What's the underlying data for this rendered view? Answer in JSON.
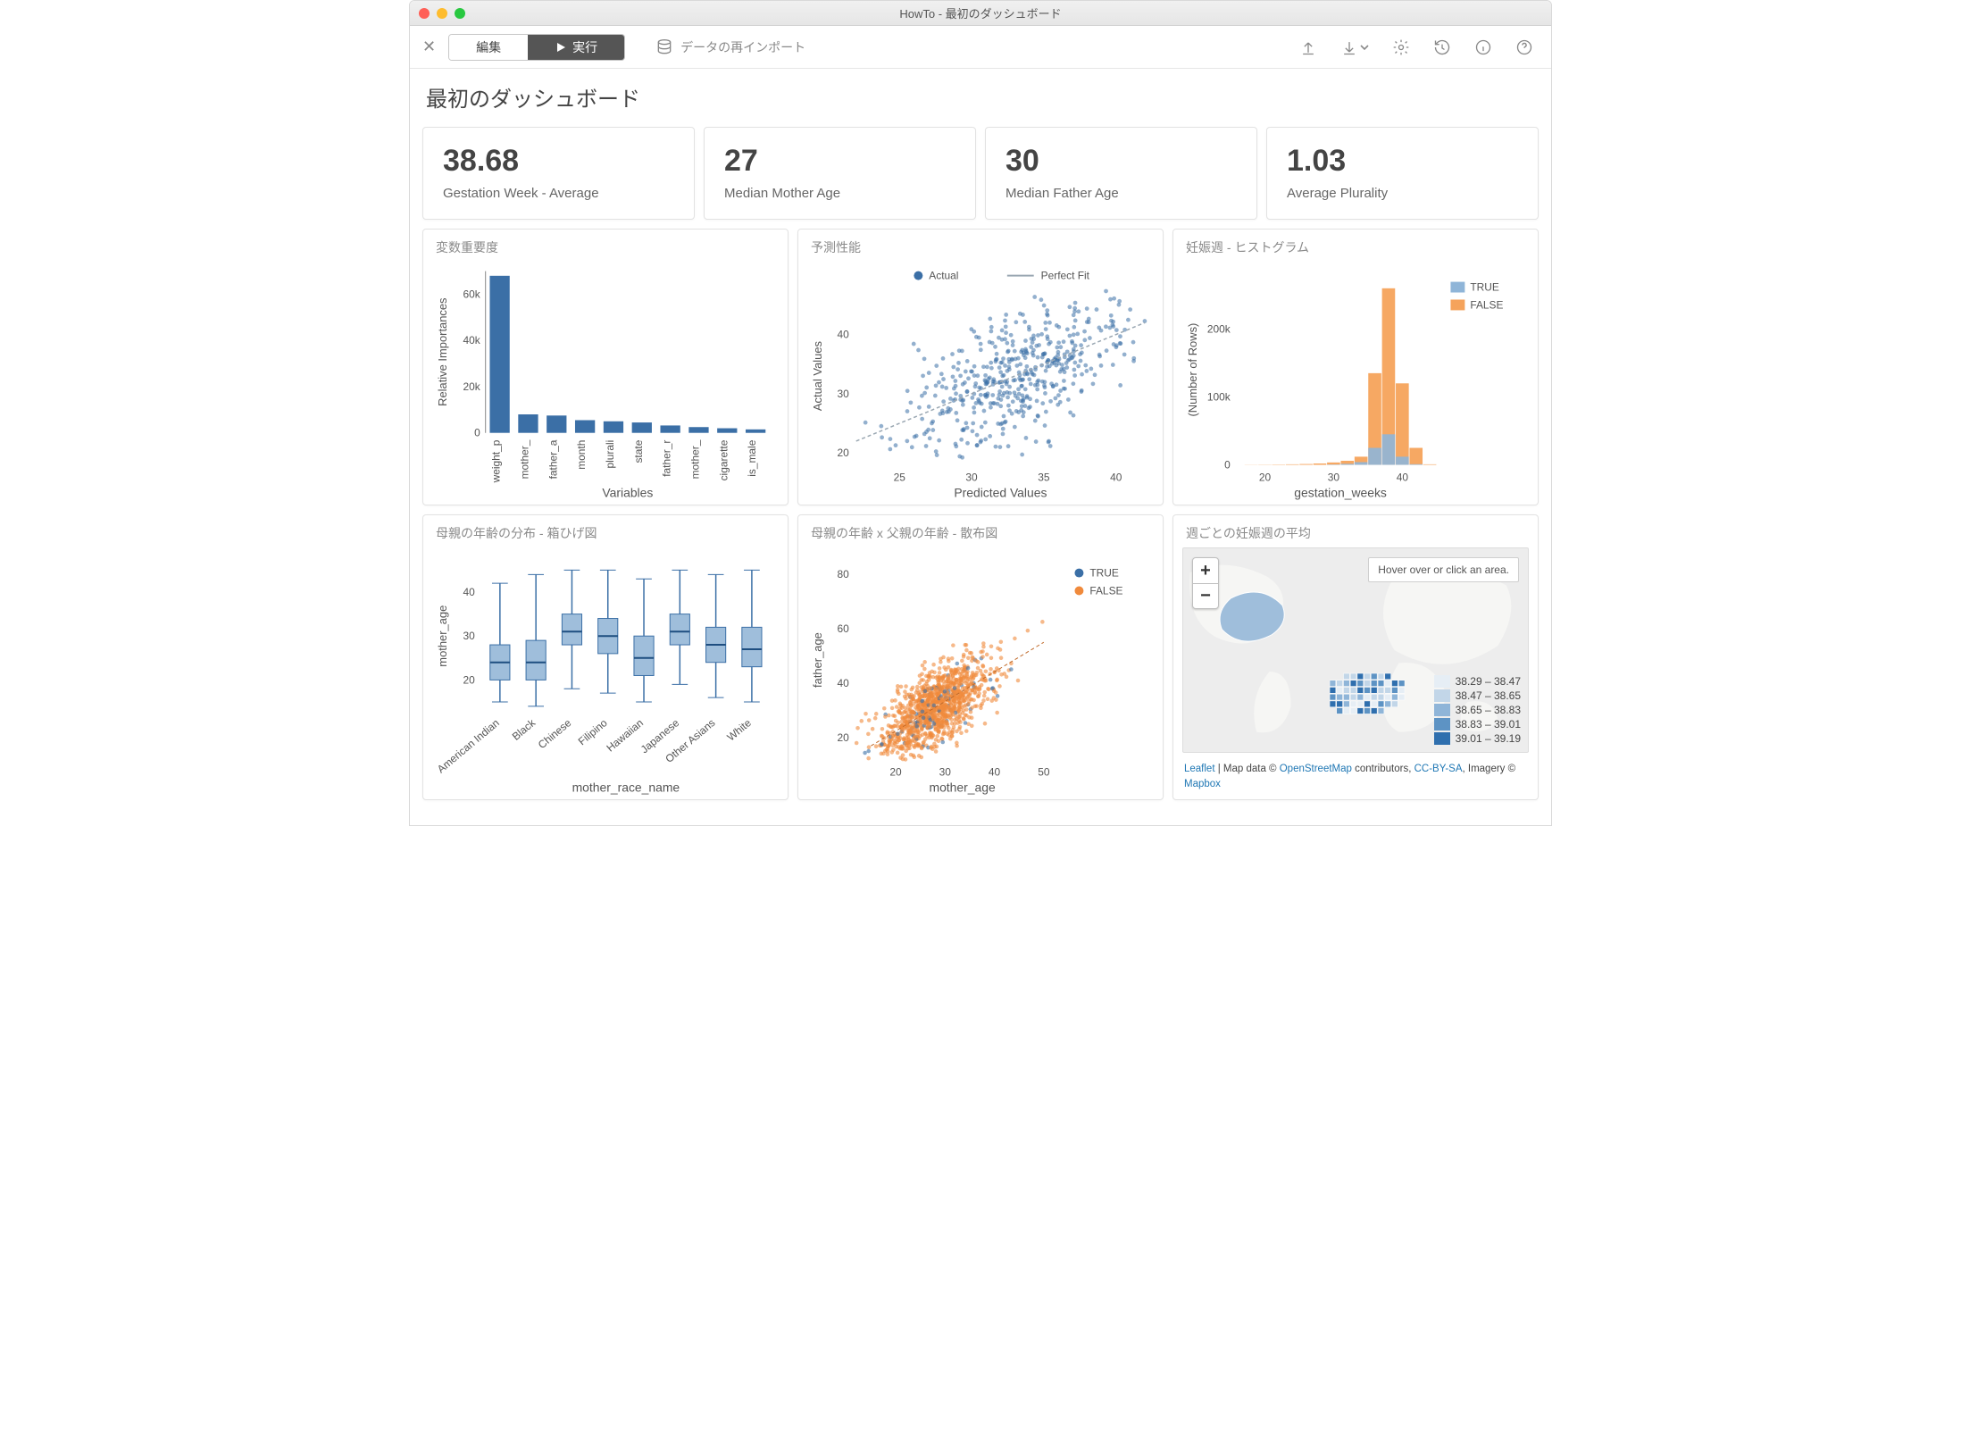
{
  "window": {
    "title": "HowTo - 最初のダッシュボード"
  },
  "toolbar": {
    "edit_label": "編集",
    "run_label": "実行",
    "reimport_label": "データの再インポート"
  },
  "page_title": "最初のダッシュボード",
  "kpis": [
    {
      "value": "38.68",
      "label": "Gestation Week - Average"
    },
    {
      "value": "27",
      "label": "Median Mother Age"
    },
    {
      "value": "30",
      "label": "Median Father Age"
    },
    {
      "value": "1.03",
      "label": "Average Plurality"
    }
  ],
  "charts": {
    "varimp": {
      "title": "変数重要度",
      "xlabel": "Variables",
      "ylabel": "Relative Importances"
    },
    "pred": {
      "title": "予測性能",
      "xlabel": "Predicted Values",
      "ylabel": "Actual Values",
      "legend_actual": "Actual",
      "legend_fit": "Perfect Fit"
    },
    "hist": {
      "title": "妊娠週 - ヒストグラム",
      "xlabel": "gestation_weeks",
      "ylabel": "(Number of Rows)",
      "legend_true": "TRUE",
      "legend_false": "FALSE"
    },
    "box": {
      "title": "母親の年齢の分布 - 箱ひげ図",
      "xlabel": "mother_race_name",
      "ylabel": "mother_age"
    },
    "scatter2": {
      "title": "母親の年齢 x 父親の年齢 - 散布図",
      "xlabel": "mother_age",
      "ylabel": "father_age",
      "legend_true": "TRUE",
      "legend_false": "FALSE"
    },
    "map": {
      "title": "週ごとの妊娠週の平均",
      "hover_hint": "Hover over or click an area.",
      "attrib_leaflet": "Leaflet",
      "attrib_sep1": " | Map data © ",
      "attrib_osm": "OpenStreetMap",
      "attrib_sep2": " contributors, ",
      "attrib_cc": "CC-BY-SA",
      "attrib_sep3": ", Imagery © ",
      "attrib_mapbox": "Mapbox"
    }
  },
  "chart_data": [
    {
      "id": "varimp",
      "type": "bar",
      "xlabel": "Variables",
      "ylabel": "Relative Importances",
      "ylim": [
        0,
        70000
      ],
      "yticks": [
        0,
        20000,
        40000,
        60000
      ],
      "ytick_labels": [
        "0",
        "20k",
        "40k",
        "60k"
      ],
      "categories": [
        "weight_p",
        "mother_",
        "father_a",
        "month",
        "plurali",
        "state",
        "father_r",
        "mother_",
        "cigarette",
        "is_male"
      ],
      "values": [
        68000,
        8000,
        7500,
        5500,
        5000,
        4500,
        3200,
        2500,
        2000,
        1500
      ]
    },
    {
      "id": "pred",
      "type": "scatter",
      "xlabel": "Predicted Values",
      "ylabel": "Actual Values",
      "xlim": [
        22,
        42
      ],
      "ylim": [
        18,
        48
      ],
      "xticks": [
        25,
        30,
        35,
        40
      ],
      "yticks": [
        20,
        30,
        40
      ],
      "series": [
        {
          "name": "Actual",
          "color": "#3b6fa6"
        },
        {
          "name": "Perfect Fit",
          "color": "#9aa7b2",
          "line": true
        }
      ],
      "approx_cloud_center": [
        33,
        33
      ],
      "approx_cloud_spread": [
        8,
        8
      ],
      "n_points_approx": 500
    },
    {
      "id": "hist",
      "type": "bar",
      "xlabel": "gestation_weeks",
      "ylabel": "(Number of Rows)",
      "xticks": [
        20,
        30,
        40
      ],
      "yticks": [
        0,
        100000,
        200000
      ],
      "ytick_labels": [
        "0",
        "100k",
        "200k"
      ],
      "bin_centers": [
        18,
        20,
        22,
        24,
        26,
        28,
        30,
        32,
        34,
        36,
        38,
        40,
        42,
        44
      ],
      "series": [
        {
          "name": "TRUE",
          "color": "#8fb5d8",
          "values": [
            0,
            0,
            0,
            0,
            0,
            0,
            500,
            1500,
            4000,
            25000,
            45000,
            12000,
            1000,
            0
          ]
        },
        {
          "name": "FALSE",
          "color": "#f5a35b",
          "values": [
            200,
            300,
            500,
            800,
            1200,
            2000,
            3500,
            6000,
            12000,
            135000,
            260000,
            120000,
            25000,
            800
          ]
        }
      ]
    },
    {
      "id": "box",
      "type": "boxplot",
      "xlabel": "mother_race_name",
      "ylabel": "mother_age",
      "yticks": [
        20,
        30,
        40
      ],
      "categories": [
        "American Indian",
        "Black",
        "Chinese",
        "Filipino",
        "Hawaiian",
        "Japanese",
        "Other Asians",
        "White"
      ],
      "boxes": [
        {
          "min": 15,
          "q1": 20,
          "med": 24,
          "q3": 28,
          "max": 42
        },
        {
          "min": 14,
          "q1": 20,
          "med": 24,
          "q3": 29,
          "max": 44
        },
        {
          "min": 18,
          "q1": 28,
          "med": 31,
          "q3": 35,
          "max": 45
        },
        {
          "min": 17,
          "q1": 26,
          "med": 30,
          "q3": 34,
          "max": 45
        },
        {
          "min": 15,
          "q1": 21,
          "med": 25,
          "q3": 30,
          "max": 43
        },
        {
          "min": 19,
          "q1": 28,
          "med": 31,
          "q3": 35,
          "max": 45
        },
        {
          "min": 16,
          "q1": 24,
          "med": 28,
          "q3": 32,
          "max": 44
        },
        {
          "min": 15,
          "q1": 23,
          "med": 27,
          "q3": 32,
          "max": 45
        }
      ]
    },
    {
      "id": "scatter2",
      "type": "scatter",
      "xlabel": "mother_age",
      "ylabel": "father_age",
      "xticks": [
        20,
        30,
        40,
        50
      ],
      "yticks": [
        20,
        40,
        60,
        80
      ],
      "xlim": [
        12,
        55
      ],
      "ylim": [
        12,
        85
      ],
      "series": [
        {
          "name": "TRUE",
          "color": "#3b6fa6"
        },
        {
          "name": "FALSE",
          "color": "#f08a3c"
        }
      ],
      "approx_cloud_center": [
        28,
        32
      ],
      "approx_cloud_spread": [
        10,
        12
      ],
      "n_points_approx": 1200
    },
    {
      "id": "map",
      "type": "choropleth",
      "legend_bins": [
        {
          "label": "38.29 – 38.47",
          "color": "#e6eef5"
        },
        {
          "label": "38.47 – 38.65",
          "color": "#c2d6e8"
        },
        {
          "label": "38.65 – 38.83",
          "color": "#8fb5d8"
        },
        {
          "label": "38.83 – 39.01",
          "color": "#5d93c4"
        },
        {
          "label": "39.01 – 39.19",
          "color": "#2f6fae"
        }
      ]
    }
  ]
}
